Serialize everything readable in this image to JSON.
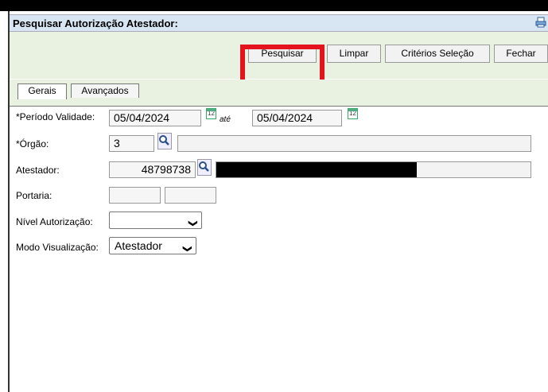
{
  "window": {
    "title": "Pesquisar Autorização Atestador:"
  },
  "toolbar": {
    "pesquisar": "Pesquisar",
    "limpar": "Limpar",
    "criterios": "Critérios Seleção",
    "fechar": "Fechar"
  },
  "tabs": {
    "gerais": "Gerais",
    "avancados": "Avançados"
  },
  "form": {
    "periodo_label": "*Período Validade:",
    "periodo_inicio": "05/04/2024",
    "ate_label": "até",
    "periodo_fim": "05/04/2024",
    "calendar_text": "12",
    "orgao_label": "*Órgão:",
    "orgao_codigo": "3",
    "orgao_nome": "",
    "atestador_label": "Atestador:",
    "atestador_codigo": "48798738",
    "atestador_nome_redacted": true,
    "portaria_label": "Portaria:",
    "portaria_1": "",
    "portaria_2": "",
    "nivel_label": "Nível Autorização:",
    "nivel_value": "",
    "modo_label": "Modo Visualização:",
    "modo_value": "Atestador"
  },
  "colors": {
    "highlight": "#e3141d",
    "toolbar_bg": "#e9f1e1",
    "titlebar_bg": "#d8e6f4"
  },
  "icons": [
    "print-icon",
    "calendar-icon",
    "magnifier-icon",
    "chevron-down-icon"
  ]
}
